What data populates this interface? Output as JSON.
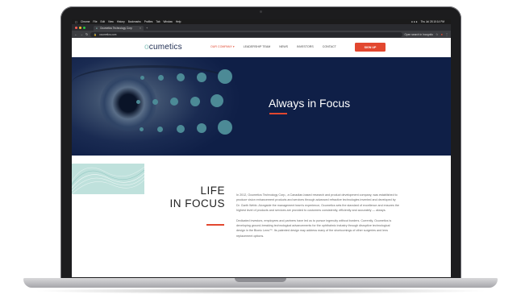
{
  "menubar": {
    "items": [
      "Chrome",
      "File",
      "Edit",
      "View",
      "History",
      "Bookmarks",
      "Profiles",
      "Tab",
      "Window",
      "Help"
    ],
    "clock": "Thu Jul 28 10:14 PM"
  },
  "browser": {
    "tab_title": "Ocumetics Technology Corp",
    "url": "ocumetics.com",
    "incognito_label": "Open search in Incognito"
  },
  "site": {
    "logo_prefix": "o",
    "logo_rest": "cumetics",
    "nav": [
      "OUR COMPANY",
      "LEADERSHIP TEAM",
      "NEWS",
      "INVESTORS",
      "CONTACT"
    ],
    "signup": "SIGN UP"
  },
  "hero": {
    "title": "Always in Focus"
  },
  "content": {
    "heading_line1": "LIFE",
    "heading_line2": "IN FOCUS",
    "paragraph1": "In 2012, Ocumetics Technology Corp., a Canadian-based research and product development company, was established to produce vision enhancement products and services through advanced refractive technologies invented and developed by Dr. Garth Webb. Alongside the management team's experience, Ocumetics sets the standard of excellence and ensures the highest level of products and services are provided to customers consistently, efficiently and accurately — always.",
    "paragraph2": "Dedicated investors, employees and partners have led us to pursue ingenuity without borders. Currently, Ocumetics is developing ground-breaking technological advancements for the ophthalmic industry through disruptive technological design in the Bionic Lens™. Its patented design may address many of the shortcomings of other surgeries and lens replacement options."
  },
  "colors": {
    "hero_bg": "#0f1f47",
    "accent": "#e2472f",
    "teal": "#8ec5c0"
  }
}
